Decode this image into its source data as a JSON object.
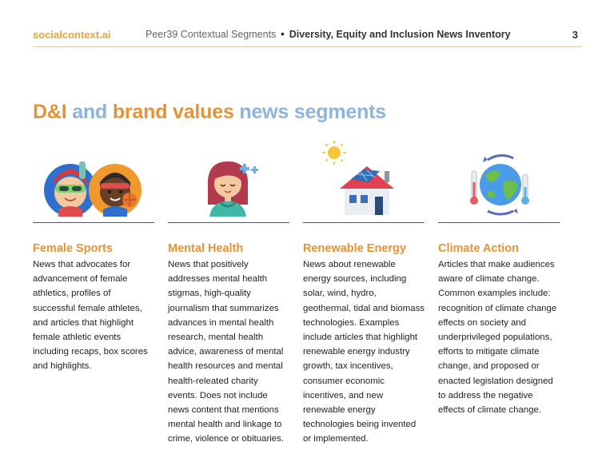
{
  "header": {
    "brand": "socialcontext.ai",
    "product": "Peer39 Contextual Segments",
    "separator": "•",
    "document": "Diversity, Equity and Inclusion News Inventory",
    "page_number": "3"
  },
  "title": {
    "part1": "D&I",
    "part2": "and",
    "part3": "brand values",
    "part4": "news segments"
  },
  "segments": [
    {
      "icon": "female-athletes-icon",
      "heading": "Female Sports",
      "description": "News that advocates for advancement of female athletics, profiles of successful female athletes, and articles that highlight female athletic events including recaps, box scores and highlights."
    },
    {
      "icon": "mental-health-woman-icon",
      "heading": "Mental Health",
      "description": "News that positively addresses mental health stigmas, high-quality journalism that summarizes advances in mental health research, mental health advice, awareness of mental health resources and mental health-releated charity events. Does not include news content that mentions mental health and linkage to crime, violence or obituaries."
    },
    {
      "icon": "solar-house-icon",
      "heading": "Renewable Energy",
      "description": "News about renewable energy sources, including solar, wind, hydro, geothermal, tidal and biomass technologies. Examples include articles that highlight renewable energy industry growth, tax incentives, consumer economic incentives, and new renewable energy technologies being invented or implemented."
    },
    {
      "icon": "globe-thermometer-icon",
      "heading": "Climate Action",
      "description": "Articles that make audiences aware of climate change. Common examples include: recognition of climate change effects on society and underprivileged populations, efforts to mitigate climate change, and proposed or enacted legislation designed to address the negative effects of climate change."
    }
  ],
  "colors": {
    "accent_orange": "#e49436",
    "accent_blue": "#8db3df",
    "rule": "#4b5563"
  }
}
